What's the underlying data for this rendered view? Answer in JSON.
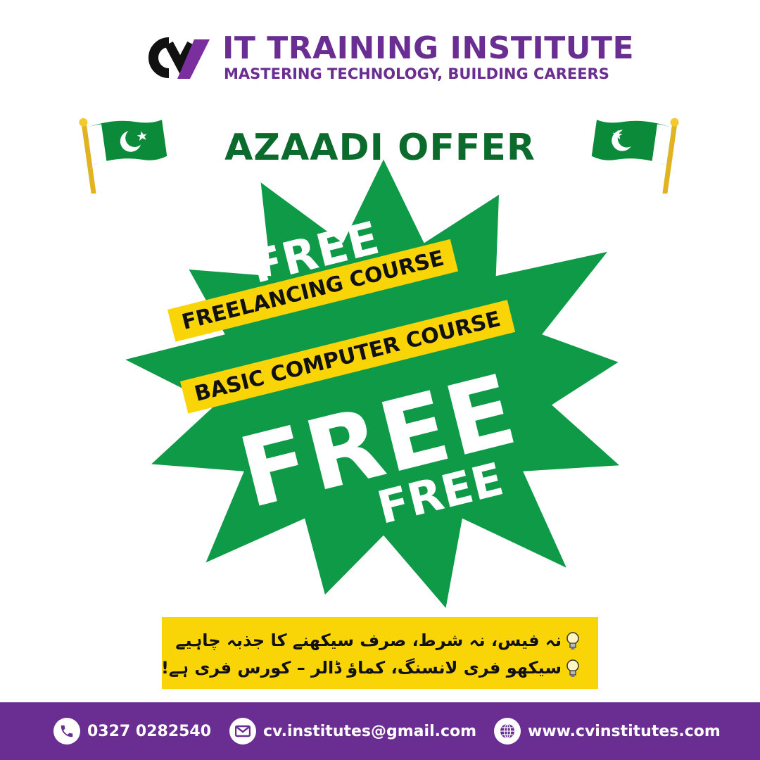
{
  "brand": {
    "title": "IT TRAINING INSTITUTE",
    "tagline": "MASTERING TECHNOLOGY, BUILDING CAREERS",
    "logo_text": "CV"
  },
  "offer": {
    "title": "AZAADI OFFER",
    "free_top": "FREE",
    "course_1": "FREELANCING COURSE",
    "course_2": "BASIC COMPUTER COURSE",
    "free_big": "FREE",
    "free_bottom": "FREE"
  },
  "urdu": {
    "line_1": "نہ فیس، نہ شرط، صرف سیکھنے کا جذبہ چاہیے",
    "line_2": "سیکھو فری لانسنگ، کماؤ ڈالر – کورس فری ہے!"
  },
  "contact": {
    "phone": "0327 0282540",
    "email": "cv.institutes@gmail.com",
    "website": "www.cvinstitutes.com"
  },
  "colors": {
    "purple": "#6a2d91",
    "green": "#0f9a48",
    "dark_green": "#0b6b2d",
    "yellow": "#f9d508",
    "flag_green": "#0b8a3a"
  },
  "icons": [
    "flag-pakistan-icon",
    "lightbulb-icon",
    "phone-icon",
    "mail-icon",
    "globe-icon"
  ]
}
